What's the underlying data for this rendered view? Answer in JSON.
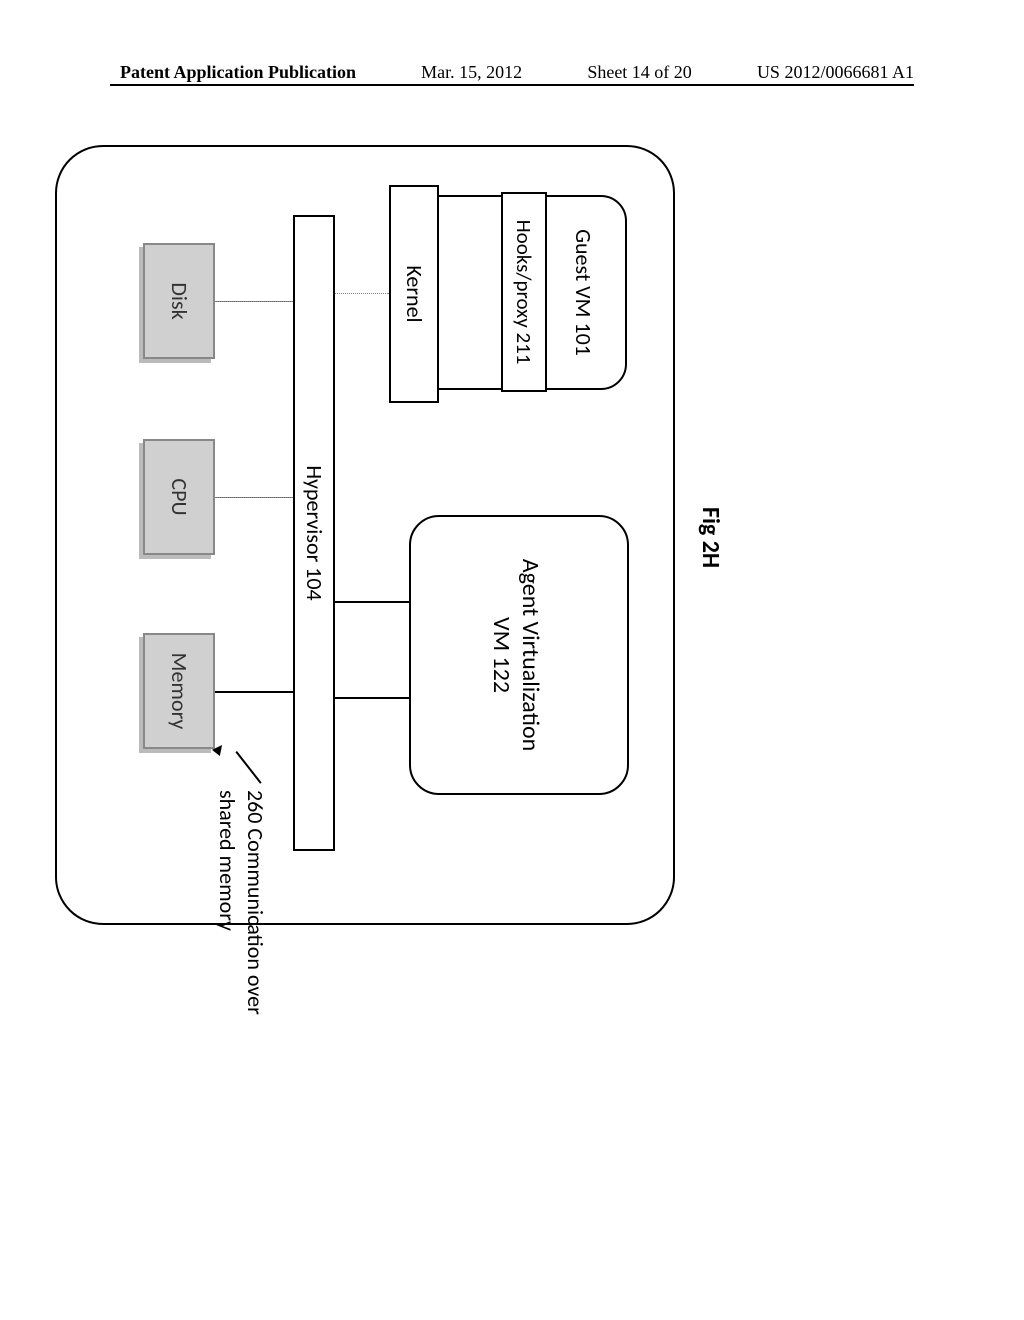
{
  "header": {
    "left": "Patent Application Publication",
    "date": "Mar. 15, 2012",
    "sheet": "Sheet 14 of 20",
    "pubno": "US 2012/0066681 A1"
  },
  "figure": {
    "title": "Fig 2H",
    "guest_vm": "Guest VM 101",
    "hooks": "Hooks/proxy 211",
    "kernel": "Kernel",
    "agent_vm_l1": "Agent Virtualization",
    "agent_vm_l2": "VM 122",
    "hypervisor": "Hypervisor 104",
    "disk": "Disk",
    "cpu": "CPU",
    "memory": "Memory",
    "annot_l1": "260 Communication over",
    "annot_l2": "shared memory"
  }
}
